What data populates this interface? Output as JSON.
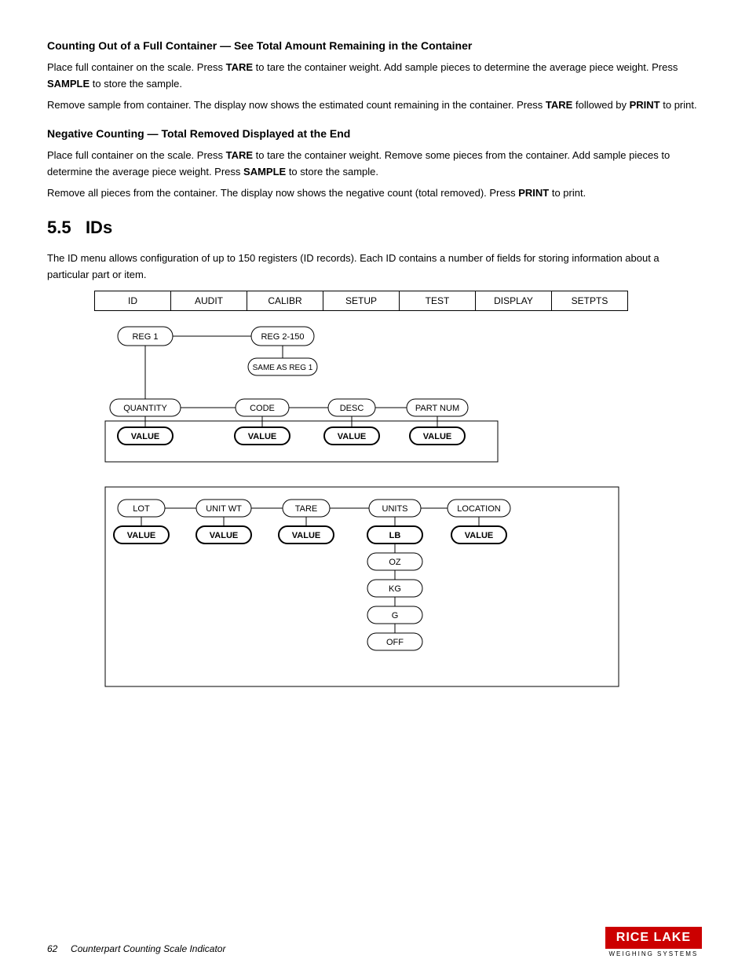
{
  "page": {
    "section1_title": "Counting Out of a Full Container — See Total Amount Remaining in the Container",
    "section1_body1": "Place full container on the scale. Press ",
    "section1_tare1": "TARE",
    "section1_body2": " to tare the container weight. Add sample pieces to determine the average piece weight. Press ",
    "section1_sample1": "SAMPLE",
    "section1_body3": " to store the sample.",
    "section1_body4": "Remove sample from container. The display now shows the estimated count remaining in the container. Press ",
    "section1_tare2": "TARE",
    "section1_body5": " followed by ",
    "section1_print1": "PRINT",
    "section1_body6": " to print.",
    "section2_title": "Negative Counting — Total Removed Displayed at the End",
    "section2_body1": "Place full container on the scale. Press ",
    "section2_tare1": "TARE",
    "section2_body2": " to tare the container weight. Remove some pieces from the container. Add sample pieces to determine the average piece weight. Press ",
    "section2_sample1": "SAMPLE",
    "section2_body3": " to store the sample.",
    "section2_body4": "Remove all pieces from the container. The display now shows the negative count (total removed). Press ",
    "section2_print1": "PRINT",
    "section2_body5": " to print.",
    "section55_number": "5.5",
    "section55_title": "IDs",
    "section55_body": "The ID menu allows configuration of up to 150 registers (ID records). Each ID contains a number of fields for storing information about a particular part or item.",
    "menu": {
      "items": [
        "ID",
        "AUDIT",
        "CALIBR",
        "SETUP",
        "TEST",
        "DISPLAY",
        "SETPTS"
      ]
    },
    "tree": {
      "reg1": "REG 1",
      "reg2": "REG 2-150",
      "sameasreg1": "SAME AS REG 1",
      "quantity": "QUANTITY",
      "code": "CODE",
      "desc": "DESC",
      "part_num": "PART NUM",
      "value": "VALUE",
      "lot": "LOT",
      "unit_wt": "UNIT WT",
      "tare": "TARE",
      "units": "UNITS",
      "location": "LOCATION",
      "lb": "LB",
      "oz": "OZ",
      "kg": "KG",
      "g": "G",
      "off": "OFF"
    },
    "footer": {
      "page": "62",
      "subtitle": "Counterpart Counting Scale Indicator",
      "logo_name": "RICE LAKE",
      "logo_sub": "WEIGHING SYSTEMS"
    }
  }
}
